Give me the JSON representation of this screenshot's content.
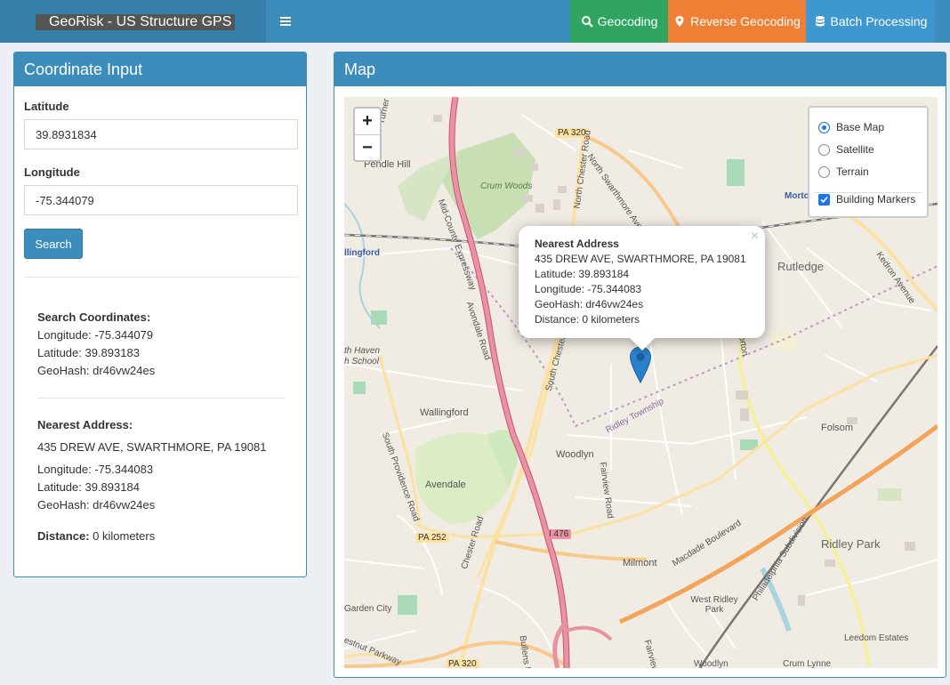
{
  "app": {
    "title": "GeoRisk - US Structure GPS"
  },
  "nav": {
    "geocoding": "Geocoding",
    "reverse": "Reverse Geocoding",
    "batch": "Batch Processing"
  },
  "input_panel": {
    "title": "Coordinate Input",
    "lat_label": "Latitude",
    "lat_value": "39.8931834",
    "lon_label": "Longitude",
    "lon_value": "-75.344079",
    "search_label": "Search"
  },
  "search": {
    "heading": "Search Coordinates:",
    "longitude": "Longitude: -75.344079",
    "latitude": "Latitude: 39.893183",
    "geohash": "GeoHash: dr46vw24es"
  },
  "nearest": {
    "heading": "Nearest Address:",
    "address": "435 DREW AVE, SWARTHMORE, PA 19081",
    "longitude": "Longitude: -75.344083",
    "latitude": "Latitude: 39.893184",
    "geohash": "GeoHash: dr46vw24es",
    "distance_label": "Distance:",
    "distance_value": " 0 kilometers"
  },
  "map": {
    "title": "Map",
    "zoom_in": "+",
    "zoom_out": "−",
    "layers": {
      "base": "Base Map",
      "satellite": "Satellite",
      "terrain": "Terrain",
      "markers": "Building Markers"
    },
    "popup": {
      "title": "Nearest Address",
      "address": "435 DREW AVE, SWARTHMORE, PA 19081",
      "latitude": "Latitude: 39.893184",
      "longitude": "Longitude: -75.344083",
      "geohash": "GeoHash: dr46vw24es",
      "distance": "Distance: 0 kilometers",
      "close": "×"
    },
    "places": [
      "Pendle Hill",
      "Crum Woods",
      "Rutledge",
      "Wallingford",
      "Woodlyn",
      "Folsom",
      "Avendale",
      "Milmont",
      "West Ridley Park",
      "Ridley Park",
      "Garden City",
      "Leedom Estates",
      "Woodlyn",
      "Crum Lynne",
      "Ridley Township",
      "llingford",
      "th Haven",
      "h School",
      "Morto"
    ],
    "roads": [
      "PA 320",
      "PA 252",
      "I 476",
      "PA 320",
      "Turner Road",
      "North Swarthmore Avenue",
      "North Chester Road",
      "Mid-County Expressway",
      "Avondale Road",
      "South Chester",
      "South Providence Road",
      "Chester Road",
      "Fairview Road",
      "Macdade Boulevard",
      "Philadelphia Subdivision",
      "Kedron Avenue",
      "Morton",
      "Bullens Lane",
      "Fairview",
      "estnut Parkway"
    ]
  },
  "colors": {
    "header": "#3c8dbc",
    "geocoding": "#2fa55f",
    "reverse": "#ee7f35",
    "batch": "#3f97cf"
  }
}
